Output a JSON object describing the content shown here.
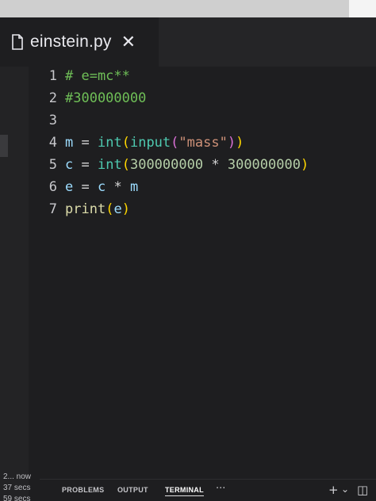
{
  "tab": {
    "file_name": "einstein.py",
    "close_glyph": "✕"
  },
  "editor": {
    "lines": [
      {
        "num": "1",
        "text": "# e=mc**"
      },
      {
        "num": "2",
        "text": "#300000000"
      },
      {
        "num": "3",
        "text": ""
      },
      {
        "num": "4",
        "text": "m = int(input(\"mass\"))"
      },
      {
        "num": "5",
        "text": "c = int(300000000 * 300000000)"
      },
      {
        "num": "6",
        "text": "e = c * m"
      },
      {
        "num": "7",
        "text": "print(e)"
      }
    ]
  },
  "status": {
    "line1": "2... now",
    "line2": "37 secs",
    "line3": "59 secs"
  },
  "panel": {
    "tabs": [
      "PROBLEMS",
      "OUTPUT",
      "TERMINAL"
    ],
    "active_tab": "TERMINAL",
    "more_glyph": "···",
    "add_glyph": "+",
    "dropdown_glyph": "⌄",
    "split_glyph": "◫"
  },
  "colors": {
    "background": "#1e1e20",
    "comment": "#6fbf57",
    "variable": "#9cdcfe",
    "function": "#dcdcaa",
    "builtin": "#4ec9b0",
    "string": "#ce9178",
    "number": "#b5cea8"
  }
}
